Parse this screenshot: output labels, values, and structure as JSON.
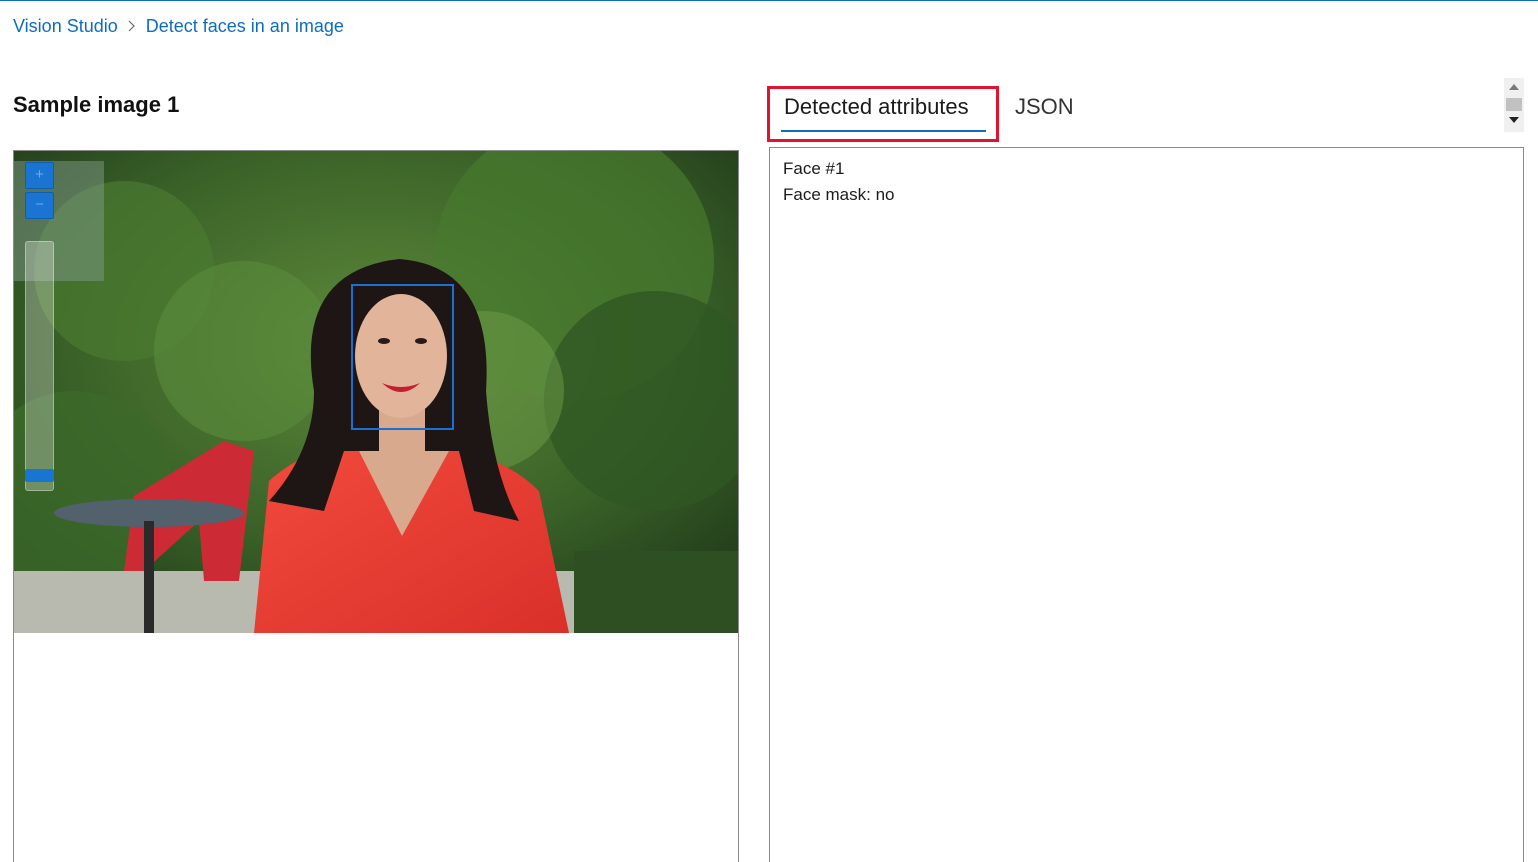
{
  "breadcrumb": {
    "items": [
      "Vision Studio",
      "Detect faces in an image"
    ]
  },
  "left_panel": {
    "title": "Sample image 1",
    "zoom_in": "+",
    "zoom_out": "−"
  },
  "tabs": {
    "active": "Detected attributes",
    "other": "JSON"
  },
  "results": {
    "face_label": "Face #1",
    "mask_label": "Face mask: no"
  },
  "colors": {
    "link": "#0f6cbd",
    "highlight_border": "#e01431",
    "face_box": "#1a6fd1"
  }
}
